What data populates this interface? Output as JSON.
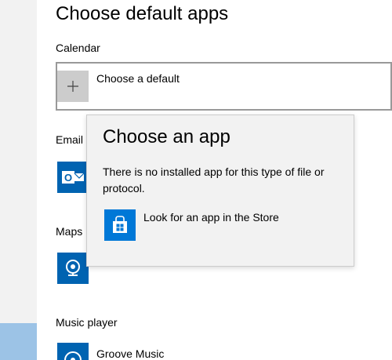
{
  "page": {
    "title": "Choose default apps"
  },
  "sections": {
    "calendar": {
      "label": "Calendar",
      "default_label": "Choose a default"
    },
    "email": {
      "label": "Email"
    },
    "maps": {
      "label": "Maps"
    },
    "music": {
      "label": "Music player",
      "app_name": "Groove Music"
    }
  },
  "flyout": {
    "title": "Choose an app",
    "body": "There is no installed app for this type of file or protocol.",
    "store_link": "Look for an app in the Store"
  },
  "icons": {
    "plus": "plus-icon",
    "outlook": "outlook-mail-icon",
    "maps": "maps-pin-icon",
    "groove": "groove-music-icon",
    "store": "store-icon"
  },
  "colors": {
    "accent": "#0063b1",
    "store_tile": "#0078d7",
    "flyout_bg": "#f2f2f2",
    "sidebar_selected": "#9cc3e6"
  }
}
